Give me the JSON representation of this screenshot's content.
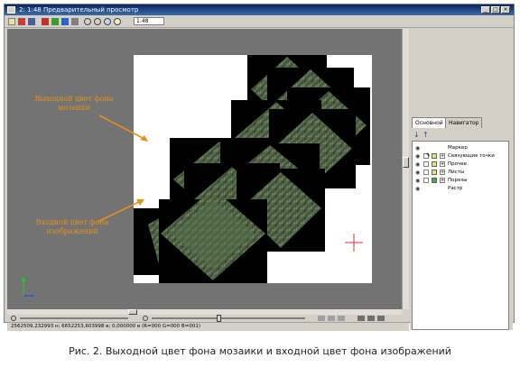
{
  "window": {
    "title": "2: 1:48 Предварительный просмотр",
    "btn_min": "_",
    "btn_max": "□",
    "btn_close": "×"
  },
  "toolbar": {
    "zoom_value": "1:48"
  },
  "annotations": {
    "output_mosaic_bg": "Выходной цвет фона мозаики",
    "input_image_bg": "Входной цвет фона изображений"
  },
  "statusbar": {
    "coords": "2562509,232993 н; 6652253,603998 в; 0,000000 в     (R=000 G=000 B=001)"
  },
  "panel": {
    "tabs": [
      "Основной",
      "Навигатор"
    ],
    "active_tab": 0,
    "layers": [
      {
        "label": "Маркер",
        "has_check": false,
        "swatch": null,
        "pencil": false,
        "expander": false
      },
      {
        "label": "Связующие точки",
        "has_check": true,
        "swatch": "#e8e860",
        "pencil": true,
        "expander": true
      },
      {
        "label": "Прочее",
        "has_check": true,
        "swatch": "#e8e860",
        "pencil": false,
        "expander": true
      },
      {
        "label": "Листы",
        "has_check": true,
        "swatch": "#e8e860",
        "pencil": false,
        "expander": true
      },
      {
        "label": "Порезы",
        "has_check": true,
        "swatch": "#44b044",
        "pencil": false,
        "expander": true
      },
      {
        "label": "Растр",
        "has_check": false,
        "swatch": null,
        "pencil": false,
        "expander": false
      }
    ]
  },
  "caption": "Рис. 2. Выходной цвет фона мозаики и входной цвет фона изображений",
  "colors": {
    "workspace": "#737373",
    "annotation": "#e8901a",
    "tile_bg": "#000000",
    "mosaic_bg": "#ffffff"
  }
}
